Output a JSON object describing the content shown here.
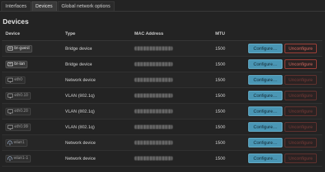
{
  "tabs": [
    {
      "label": "Interfaces",
      "active": false
    },
    {
      "label": "Devices",
      "active": true
    },
    {
      "label": "Global network options",
      "active": false
    }
  ],
  "section_title": "Devices",
  "columns": {
    "device": "Device",
    "type": "Type",
    "mac": "MAC Address",
    "mtu": "MTU"
  },
  "rows": [
    {
      "name": "br-guest",
      "icon": "bridge-icon",
      "type": "Bridge device",
      "mtu": "1500",
      "configure": "Configure…",
      "unconfigure": "Unconfigure",
      "active": true
    },
    {
      "name": "br-lan",
      "icon": "bridge-icon",
      "type": "Bridge device",
      "mtu": "1500",
      "configure": "Configure…",
      "unconfigure": "Unconfigure",
      "active": true
    },
    {
      "name": "eth0",
      "icon": "ethernet-icon",
      "type": "Network device",
      "mtu": "1500",
      "configure": "Configure…",
      "unconfigure": "Unconfigure",
      "active": false
    },
    {
      "name": "eth0.10",
      "icon": "ethernet-icon",
      "type": "VLAN (802.1q)",
      "mtu": "1500",
      "configure": "Configure…",
      "unconfigure": "Unconfigure",
      "active": false
    },
    {
      "name": "eth0.20",
      "icon": "ethernet-icon",
      "type": "VLAN (802.1q)",
      "mtu": "1500",
      "configure": "Configure…",
      "unconfigure": "Unconfigure",
      "active": false
    },
    {
      "name": "eth0.99",
      "icon": "ethernet-icon",
      "type": "VLAN (802.1q)",
      "mtu": "1500",
      "configure": "Configure…",
      "unconfigure": "Unconfigure",
      "active": false
    },
    {
      "name": "wlan1",
      "icon": "wifi-icon",
      "type": "Network device",
      "mtu": "1500",
      "configure": "Configure…",
      "unconfigure": "Unconfigure",
      "active": false
    },
    {
      "name": "wlan1-1",
      "icon": "wifi-icon",
      "type": "Network device",
      "mtu": "1500",
      "configure": "Configure…",
      "unconfigure": "Unconfigure",
      "active": false
    }
  ],
  "colors": {
    "background": "#232323",
    "configure_button": "#4a96b4",
    "unconfigure_border": "#b0443c"
  }
}
